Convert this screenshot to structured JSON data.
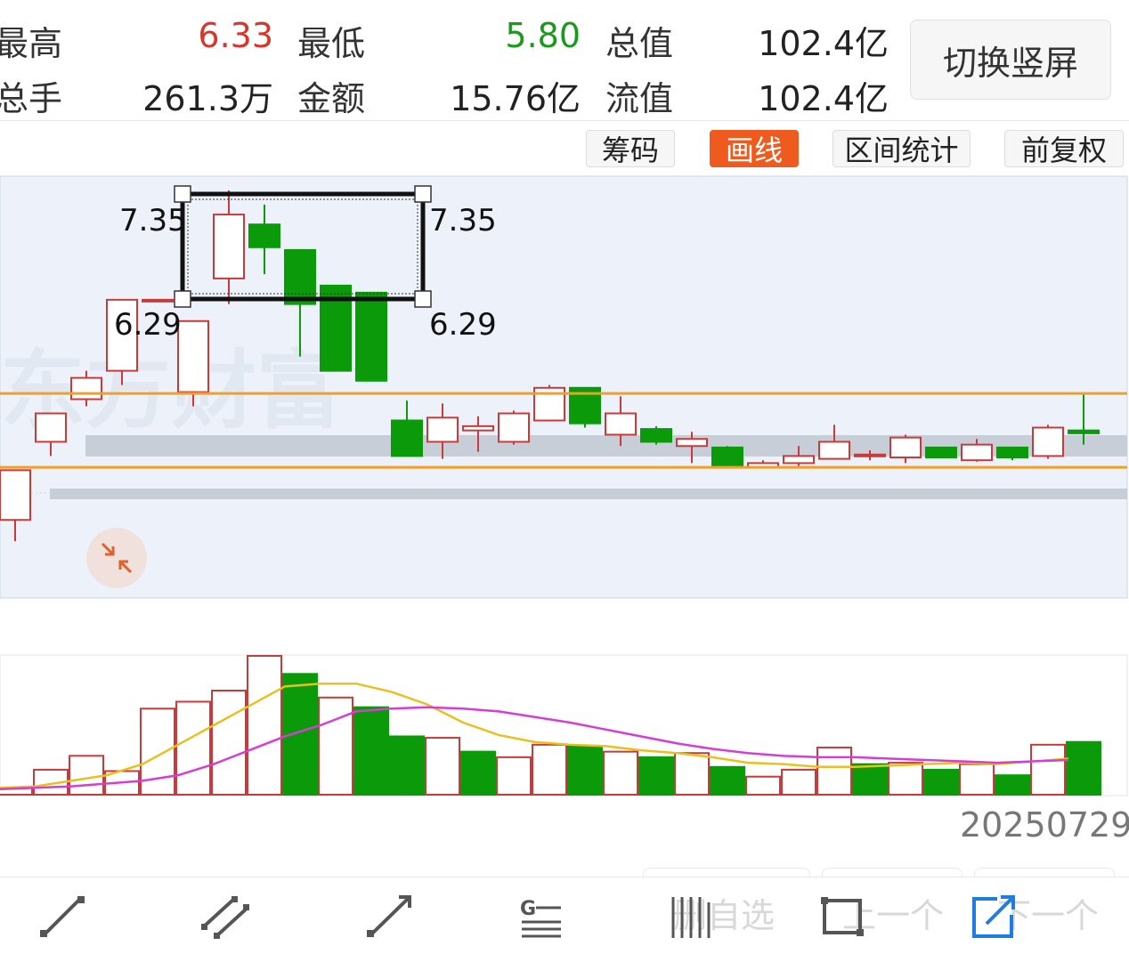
{
  "stats": {
    "row1": [
      {
        "label": "最高",
        "value": "6.33",
        "color": "#d9362b"
      },
      {
        "label": "最低",
        "value": "5.80",
        "color": "#1a9a1a"
      },
      {
        "label": "总值",
        "value": "102.4亿",
        "color": "#222222"
      }
    ],
    "row2": [
      {
        "label": "总手",
        "value": "261.3万",
        "color": "#222222"
      },
      {
        "label": "金额",
        "value": "15.76亿",
        "color": "#222222"
      },
      {
        "label": "流值",
        "value": "102.4亿",
        "color": "#222222"
      }
    ]
  },
  "switch_button": "切换竖屏",
  "tools": {
    "chips": "筹码",
    "draw": "画线",
    "range_stats": "区间统计",
    "adjust": "前复权"
  },
  "watermark": "东方财富",
  "annotations": {
    "rect_top_left": "7.35",
    "rect_top_right": "7.35",
    "rect_bottom_left": "6.29",
    "rect_bottom_right": "6.29"
  },
  "date": "20250729",
  "bottom_ghost_text": {
    "remove_watch": "删自选",
    "prev": "上一个",
    "next": "下一个"
  },
  "bottom_tools": [
    "line-segment-icon",
    "parallel-lines-icon",
    "ray-icon",
    "gann-icon",
    "vertical-lines-icon",
    "rectangle-icon",
    "extend-arrow-icon"
  ],
  "colors": {
    "up": "#c93a3a",
    "down": "#0a9a0a",
    "accent": "#ef5a1e",
    "support_line": "#f0a028",
    "ma5": "#e8c020",
    "ma10": "#d63cd6"
  },
  "chart_data": {
    "type": "candlestick",
    "candles": [
      {
        "o": 5.0,
        "c": 5.3,
        "h": 5.3,
        "l": 5.0
      },
      {
        "o": 5.4,
        "c": 5.75,
        "h": 5.75,
        "l": 5.25
      },
      {
        "o": 5.95,
        "c": 6.15,
        "h": 6.15,
        "l": 5.85
      },
      {
        "o": 6.25,
        "c": 6.4,
        "h": 6.45,
        "l": 6.2
      },
      {
        "o": 6.45,
        "c": 6.95,
        "h": 6.95,
        "l": 6.35
      },
      {
        "o": 6.95,
        "c": 6.95,
        "h": 6.95,
        "l": 6.95
      },
      {
        "o": 6.3,
        "c": 6.8,
        "h": 6.8,
        "l": 6.2
      },
      {
        "o": 7.1,
        "c": 7.55,
        "h": 7.72,
        "l": 6.92
      },
      {
        "o": 7.48,
        "c": 7.32,
        "h": 7.62,
        "l": 7.13
      },
      {
        "o": 7.3,
        "c": 6.92,
        "h": 7.3,
        "l": 6.55
      },
      {
        "o": 7.05,
        "c": 6.45,
        "h": 7.05,
        "l": 6.45
      },
      {
        "o": 7.0,
        "c": 6.38,
        "h": 7.0,
        "l": 6.38
      },
      {
        "o": 6.1,
        "c": 5.85,
        "h": 6.24,
        "l": 5.85
      },
      {
        "o": 5.95,
        "c": 6.12,
        "h": 6.22,
        "l": 5.83
      },
      {
        "o": 6.03,
        "c": 6.06,
        "h": 6.13,
        "l": 5.88
      },
      {
        "o": 5.95,
        "c": 6.15,
        "h": 6.17,
        "l": 5.93
      },
      {
        "o": 6.1,
        "c": 6.33,
        "h": 6.35,
        "l": 6.1
      },
      {
        "o": 6.33,
        "c": 6.08,
        "h": 6.33,
        "l": 6.05
      },
      {
        "o": 6.0,
        "c": 6.15,
        "h": 6.27,
        "l": 5.92
      },
      {
        "o": 6.04,
        "c": 5.95,
        "h": 6.06,
        "l": 5.93
      },
      {
        "o": 5.92,
        "c": 5.97,
        "h": 6.02,
        "l": 5.8
      },
      {
        "o": 5.91,
        "c": 5.77,
        "h": 5.92,
        "l": 5.77
      },
      {
        "o": 5.77,
        "c": 5.8,
        "h": 5.82,
        "l": 5.77
      },
      {
        "o": 5.8,
        "c": 5.85,
        "h": 5.92,
        "l": 5.78
      },
      {
        "o": 5.83,
        "c": 5.95,
        "h": 6.07,
        "l": 5.83
      },
      {
        "o": 5.86,
        "c": 5.86,
        "h": 5.89,
        "l": 5.82
      },
      {
        "o": 5.84,
        "c": 5.98,
        "h": 6.0,
        "l": 5.8
      },
      {
        "o": 5.91,
        "c": 5.84,
        "h": 5.91,
        "l": 5.84
      },
      {
        "o": 5.82,
        "c": 5.93,
        "h": 5.97,
        "l": 5.81
      },
      {
        "o": 5.91,
        "c": 5.84,
        "h": 5.91,
        "l": 5.82
      },
      {
        "o": 5.85,
        "c": 6.05,
        "h": 6.07,
        "l": 5.83
      },
      {
        "o": 6.03,
        "c": 6.01,
        "h": 6.29,
        "l": 5.93
      }
    ],
    "volume": [
      {
        "v": 0.05,
        "up": true
      },
      {
        "v": 0.18,
        "up": true
      },
      {
        "v": 0.28,
        "up": true
      },
      {
        "v": 0.17,
        "up": true
      },
      {
        "v": 0.62,
        "up": true
      },
      {
        "v": 0.67,
        "up": true
      },
      {
        "v": 0.75,
        "up": true
      },
      {
        "v": 1.0,
        "up": true
      },
      {
        "v": 0.87,
        "up": false
      },
      {
        "v": 0.7,
        "up": true
      },
      {
        "v": 0.63,
        "up": false
      },
      {
        "v": 0.42,
        "up": false
      },
      {
        "v": 0.41,
        "up": true
      },
      {
        "v": 0.31,
        "up": false
      },
      {
        "v": 0.27,
        "up": true
      },
      {
        "v": 0.36,
        "up": true
      },
      {
        "v": 0.35,
        "up": false
      },
      {
        "v": 0.31,
        "up": true
      },
      {
        "v": 0.27,
        "up": false
      },
      {
        "v": 0.3,
        "up": true
      },
      {
        "v": 0.2,
        "up": false
      },
      {
        "v": 0.13,
        "up": true
      },
      {
        "v": 0.18,
        "up": true
      },
      {
        "v": 0.34,
        "up": true
      },
      {
        "v": 0.22,
        "up": false
      },
      {
        "v": 0.23,
        "up": true
      },
      {
        "v": 0.18,
        "up": false
      },
      {
        "v": 0.22,
        "up": true
      },
      {
        "v": 0.14,
        "up": false
      },
      {
        "v": 0.36,
        "up": true
      },
      {
        "v": 0.38,
        "up": false
      }
    ],
    "ma5": [
      0.05,
      0.06,
      0.1,
      0.14,
      0.22,
      0.36,
      0.5,
      0.64,
      0.78,
      0.8,
      0.8,
      0.74,
      0.65,
      0.52,
      0.43,
      0.38,
      0.36,
      0.35,
      0.32,
      0.3,
      0.27,
      0.23,
      0.22,
      0.2,
      0.2,
      0.21,
      0.22,
      0.23,
      0.22,
      0.24,
      0.26
    ],
    "ma10": [
      0.04,
      0.05,
      0.06,
      0.08,
      0.1,
      0.14,
      0.22,
      0.32,
      0.42,
      0.5,
      0.6,
      0.62,
      0.63,
      0.62,
      0.6,
      0.56,
      0.52,
      0.47,
      0.42,
      0.37,
      0.33,
      0.3,
      0.28,
      0.27,
      0.27,
      0.26,
      0.25,
      0.24,
      0.23,
      0.24,
      0.25
    ],
    "support_levels": [
      6.29,
      5.77
    ],
    "ylim_display": [
      4.85,
      7.82
    ]
  }
}
